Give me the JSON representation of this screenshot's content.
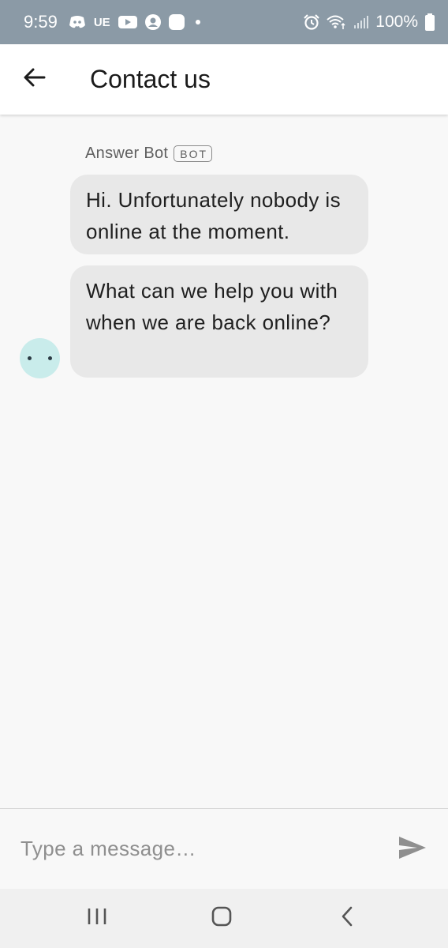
{
  "status_bar": {
    "time": "9:59",
    "notification_label": "UE",
    "battery": "100%",
    "icons": [
      "discord-icon",
      "youtube-icon",
      "account-icon",
      "app-icon",
      "dot-icon",
      "alarm-icon",
      "wifi-icon",
      "signal-icon",
      "battery-icon"
    ]
  },
  "header": {
    "title": "Contact us",
    "back_icon": "arrow-left-icon"
  },
  "chat": {
    "sender_name": "Answer Bot",
    "sender_badge": "BOT",
    "messages": [
      {
        "text": "Hi. Unfortunately nobody is online at the moment."
      },
      {
        "text": "What can we help you with when we are back online?"
      }
    ],
    "avatar_icon": "bot-avatar-icon"
  },
  "composer": {
    "placeholder": "Type a message…",
    "value": "",
    "send_icon": "send-icon"
  },
  "nav_bar": {
    "recent_icon": "recent-apps-icon",
    "home_icon": "home-icon",
    "back_icon": "back-chevron-icon"
  },
  "colors": {
    "status_bar_bg": "#8b9aa6",
    "bubble_bg": "#e8e8e8",
    "avatar_bg": "#c9eceb",
    "background": "#f8f8f8"
  }
}
